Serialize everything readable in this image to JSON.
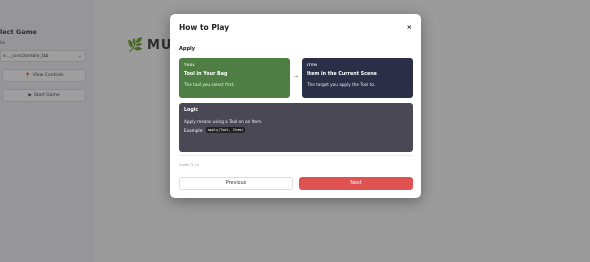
{
  "sidebar": {
    "title": "lect Game",
    "label": "ile",
    "select_value": "e..._ions/zombie_lab",
    "view_controls": "View Controls",
    "start_game": "Start Game"
  },
  "main": {
    "logo_text": "MU"
  },
  "modal": {
    "title": "How to Play",
    "close": "×",
    "section": "Apply",
    "tool_card": {
      "tag": "TOOL",
      "name": "Tool in Your Bag",
      "desc": "The tool you select first."
    },
    "arrow": "→",
    "item_card": {
      "tag": "ITEM",
      "name": "Item in the Current Scene",
      "desc": "The target you apply the Tool to."
    },
    "logic_card": {
      "name": "Logic",
      "desc": "Apply means using a Tool on an Item.",
      "example_label": "Example:",
      "example_code": "apply(Tool, Item)"
    },
    "guide": "Guide 3 / 4",
    "prev_label": "Previous",
    "next_label": "Next"
  },
  "colors": {
    "tool_card": "#4e7e43",
    "item_card": "#2a2f47",
    "logic_card": "#4a4855",
    "next_button": "#e05252"
  }
}
